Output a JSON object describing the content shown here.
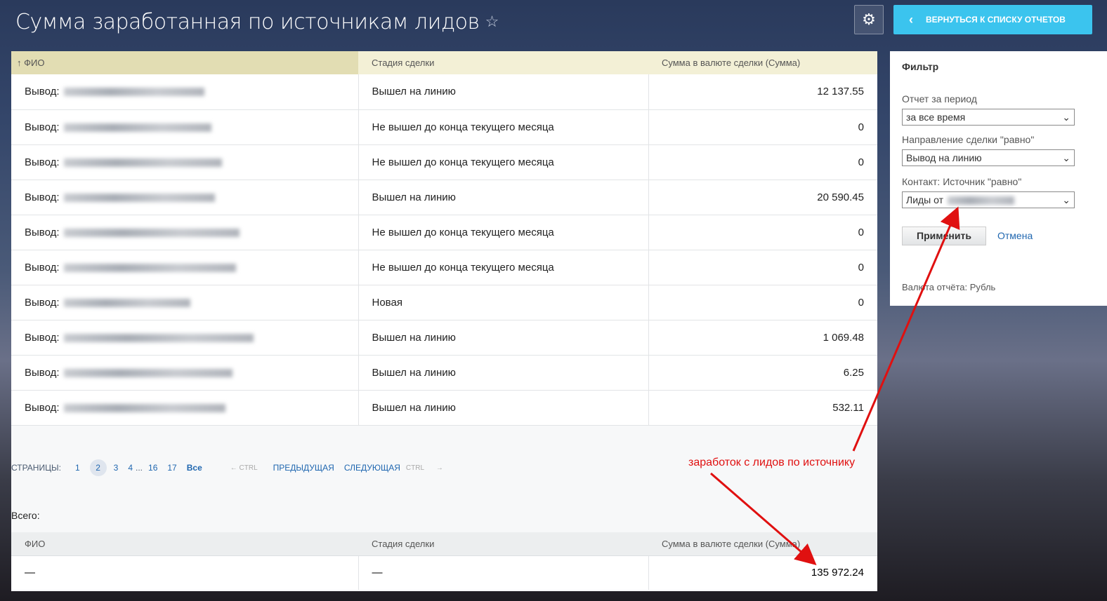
{
  "header": {
    "title": "Сумма заработанная по источникам лидов",
    "back_label": "ВЕРНУТЬСЯ К СПИСКУ ОТЧЕТОВ"
  },
  "table": {
    "columns": [
      "ФИО",
      "Стадия сделки",
      "Сумма в валюте сделки (Сумма)"
    ],
    "sort_indicator": "↑",
    "rows": [
      {
        "prefix": "Вывод:",
        "stage": "Вышел на линию",
        "sum": "12 137.55"
      },
      {
        "prefix": "Вывод:",
        "stage": "Не вышел до конца текущего месяца",
        "sum": "0"
      },
      {
        "prefix": "Вывод:",
        "stage": "Не вышел до конца текущего месяца",
        "sum": "0"
      },
      {
        "prefix": "Вывод:",
        "stage": "Вышел на линию",
        "sum": "20 590.45"
      },
      {
        "prefix": "Вывод:",
        "stage": "Не вышел до конца текущего месяца",
        "sum": "0"
      },
      {
        "prefix": "Вывод:",
        "stage": "Не вышел до конца текущего месяца",
        "sum": "0"
      },
      {
        "prefix": "Вывод:",
        "stage": "Новая",
        "sum": "0"
      },
      {
        "prefix": "Вывод:",
        "stage": "Вышел на линию",
        "sum": "1 069.48"
      },
      {
        "prefix": "Вывод:",
        "stage": "Вышел на линию",
        "sum": "6.25"
      },
      {
        "prefix": "Вывод:",
        "stage": "Вышел на линию",
        "sum": "532.11"
      }
    ]
  },
  "pager": {
    "label": "СТРАНИЦЫ:",
    "pages": [
      "1",
      "2",
      "3",
      "4",
      "16",
      "17"
    ],
    "ellipsis": "...",
    "all": "Все",
    "ctrl": "CTRL",
    "prev": "ПРЕДЫДУЩАЯ",
    "next": "СЛЕДУЮЩАЯ",
    "current": "2"
  },
  "totals": {
    "label": "Всего:",
    "columns": [
      "ФИО",
      "Стадия сделки",
      "Сумма в валюте сделки (Сумма)"
    ],
    "row": [
      "—",
      "—",
      "135 972.24"
    ]
  },
  "filter": {
    "title": "Фильтр",
    "period_label": "Отчет за период",
    "period_value": "за все время",
    "direction_label": "Направление сделки \"равно\"",
    "direction_value": "Вывод на линию",
    "source_label": "Контакт: Источник \"равно\"",
    "source_value": "Лиды от",
    "apply": "Применить",
    "cancel": "Отмена",
    "currency": "Валюта отчёта: Рубль"
  },
  "annotation": {
    "text": "заработок с лидов по источнику",
    "color": "#e01010"
  }
}
